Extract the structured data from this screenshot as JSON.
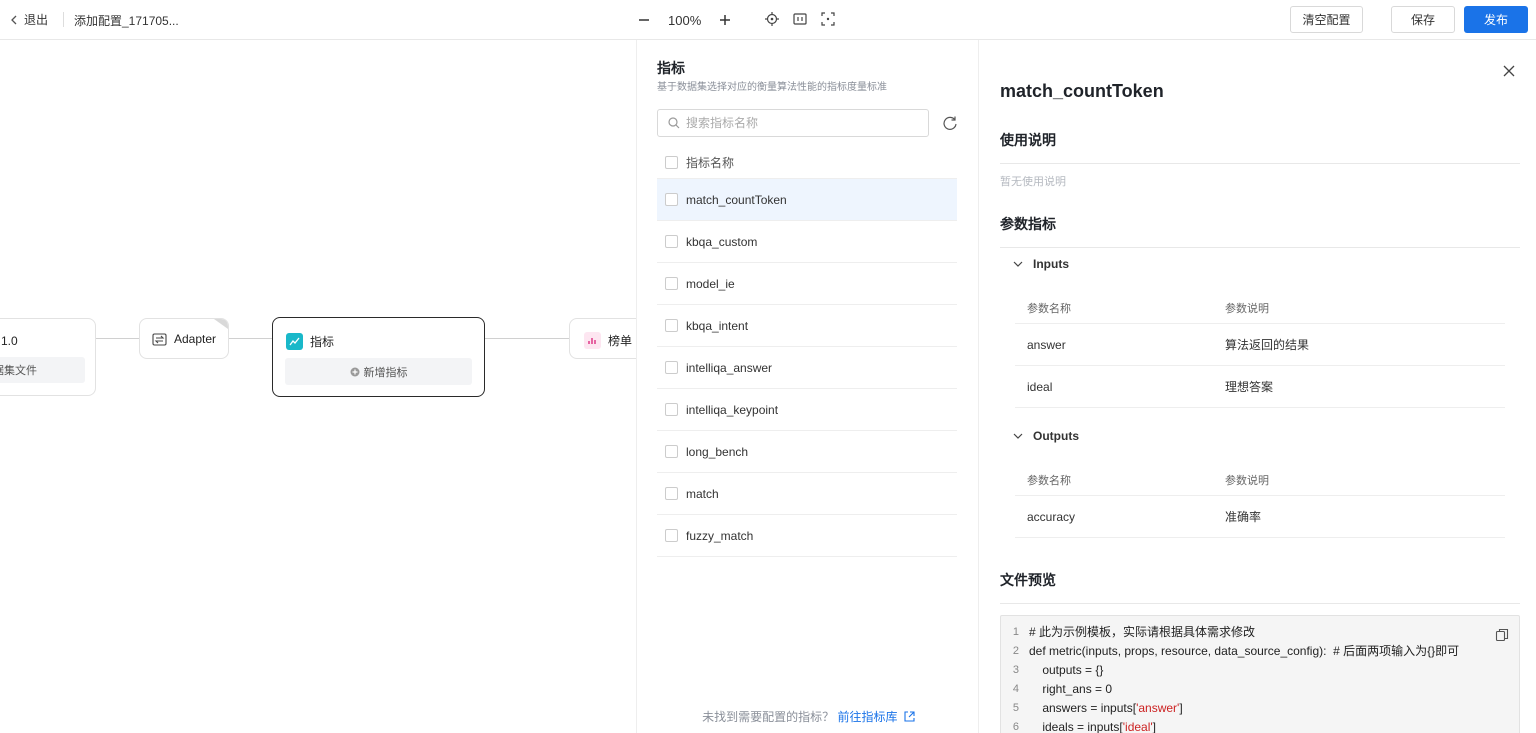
{
  "topbar": {
    "back_label": "退出",
    "config_title": "添加配置_171705...",
    "zoom_level": "100%",
    "clear_label": "清空配置",
    "save_label": "保存",
    "publish_label": "发布"
  },
  "canvas": {
    "node1": {
      "title": "1.0",
      "sub": "据集文件"
    },
    "adapter": {
      "title": "Adapter"
    },
    "metric": {
      "title": "指标",
      "add_label": "新增指标"
    },
    "leaderboard": {
      "title": "榜单"
    }
  },
  "metric_panel": {
    "title": "指标",
    "subtitle": "基于数据集选择对应的衡量算法性能的指标度量标准",
    "search_placeholder": "搜索指标名称",
    "header_label": "指标名称",
    "items": [
      {
        "name": "match_countToken",
        "active": true
      },
      {
        "name": "kbqa_custom"
      },
      {
        "name": "model_ie"
      },
      {
        "name": "kbqa_intent"
      },
      {
        "name": "intelliqa_answer"
      },
      {
        "name": "intelliqa_keypoint"
      },
      {
        "name": "long_bench"
      },
      {
        "name": "match"
      },
      {
        "name": "fuzzy_match"
      }
    ],
    "footer_text": "未找到需要配置的指标？",
    "footer_link": "前往指标库"
  },
  "detail": {
    "title": "match_countToken",
    "usage_heading": "使用说明",
    "usage_empty": "暂无使用说明",
    "params_heading": "参数指标",
    "inputs_label": "Inputs",
    "outputs_label": "Outputs",
    "col_name": "参数名称",
    "col_desc": "参数说明",
    "inputs": [
      {
        "name": "answer",
        "desc": "算法返回的结果"
      },
      {
        "name": "ideal",
        "desc": "理想答案"
      }
    ],
    "outputs": [
      {
        "name": "accuracy",
        "desc": "准确率"
      }
    ],
    "preview_heading": "文件预览",
    "code_lines": [
      {
        "n": "1",
        "pre": "# 此为示例模板，实际请根据具体需求修改",
        "str": "",
        "post": ""
      },
      {
        "n": "2",
        "pre": "def metric(inputs, props, resource, data_source_config):  # 后面两项输入为{}即可",
        "str": "",
        "post": ""
      },
      {
        "n": "3",
        "pre": "    outputs = {}",
        "str": "",
        "post": ""
      },
      {
        "n": "4",
        "pre": "    right_ans = 0",
        "str": "",
        "post": ""
      },
      {
        "n": "5",
        "pre": "    answers = inputs[",
        "str": "'answer'",
        "post": "]"
      },
      {
        "n": "6",
        "pre": "    ideals = inputs[",
        "str": "'ideal'",
        "post": "]"
      }
    ]
  }
}
